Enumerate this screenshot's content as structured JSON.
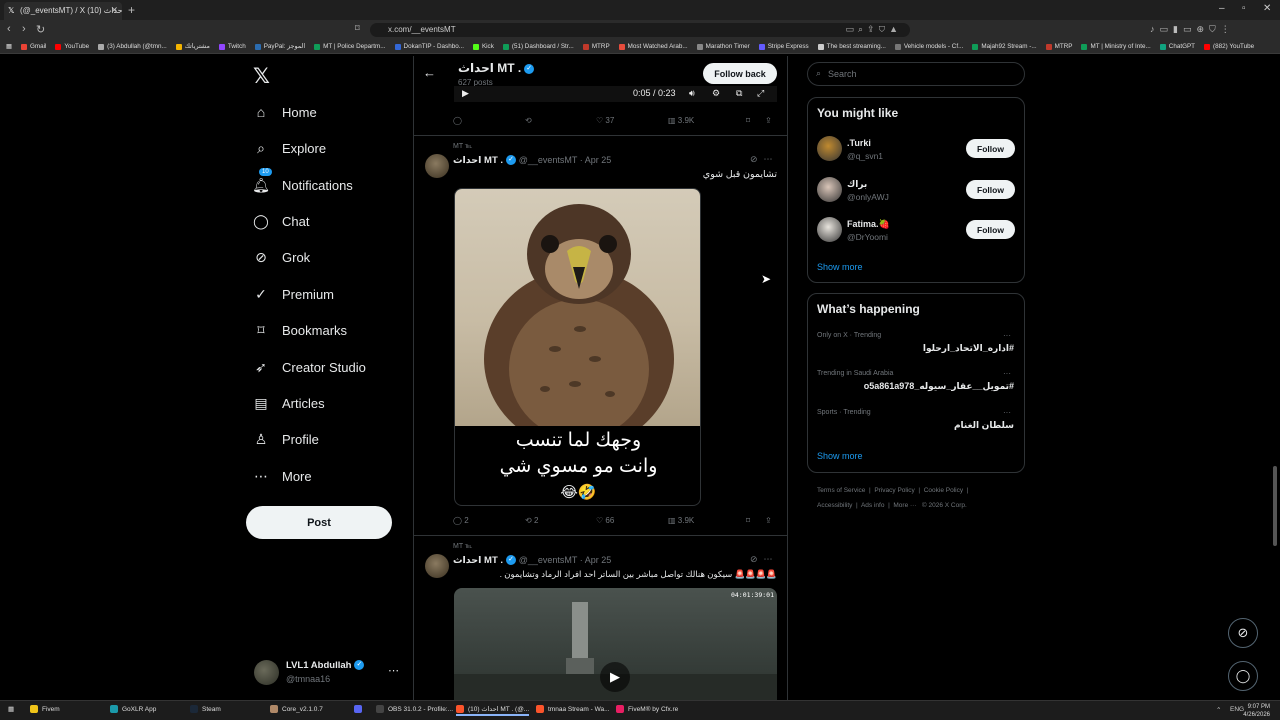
{
  "browser": {
    "tab_title": "(@_eventsMT) / X احداث (10)",
    "url": "x.com/__eventsMT",
    "bookmarks": [
      "Gmail",
      "YouTube",
      "(3) Abdullah (@tmn...",
      "مشترياتك",
      "Twitch",
      "PayPal: الموجز",
      "MT | Police Departm...",
      "DokanTIP - Dashbo...",
      "Kick",
      "(51) Dashboard / Str...",
      "MTRP",
      "Most Watched Arab...",
      "Marathon Timer",
      "Stripe Express",
      "The best streaming...",
      "Vehicle models - Cf...",
      "Majah92 Stream -...",
      "MTRP",
      "MT | Ministry of Inte...",
      "ChatGPT",
      "(882) YouTube"
    ],
    "bookmark_colors": [
      "#ea4335",
      "#ff0000",
      "#aaaaaa",
      "#f4b400",
      "#9146ff",
      "#2b6cb0",
      "#0f9d58",
      "#3367d6",
      "#53fc18",
      "#0f9d58",
      "#c0392b",
      "#e74c3c",
      "#888888",
      "#635bff",
      "#cccccc",
      "#777777",
      "#0f9d58",
      "#c0392b",
      "#0f9d58",
      "#10a37f",
      "#ff0000"
    ]
  },
  "sidebar": {
    "logo": "𝕏",
    "items": [
      {
        "label": "Home",
        "icon": "⌂",
        "name": "home"
      },
      {
        "label": "Explore",
        "icon": "⌕",
        "name": "explore"
      },
      {
        "label": "Notifications",
        "icon": "🔔︎",
        "name": "notifications"
      },
      {
        "label": "Chat",
        "icon": "◯",
        "name": "chat"
      },
      {
        "label": "Grok",
        "icon": "⊘",
        "name": "grok"
      },
      {
        "label": "Premium",
        "icon": "✓",
        "name": "premium"
      },
      {
        "label": "Bookmarks",
        "icon": "⌑",
        "name": "bookmarks"
      },
      {
        "label": "Creator Studio",
        "icon": "➶",
        "name": "creator-studio"
      },
      {
        "label": "Articles",
        "icon": "▤",
        "name": "articles"
      },
      {
        "label": "Profile",
        "icon": "♙",
        "name": "profile"
      },
      {
        "label": "More",
        "icon": "⋯",
        "name": "more"
      }
    ],
    "notif_count": "10",
    "post_label": "Post",
    "account": {
      "name": "LVL1 Abdullah",
      "handle": "@tmnaa16",
      "more": "⋯"
    }
  },
  "profile_header": {
    "back": "←",
    "title": "احداث MT .",
    "posts_count": "627 posts",
    "follow_back_label": "Follow back"
  },
  "video_top": {
    "time": "0:05 / 0:23",
    "play": "▶",
    "volume": "🔊︎",
    "settings": "⚙",
    "pip": "⧉",
    "fullscreen": "⤢"
  },
  "posts": [
    {
      "actions": {
        "reply": "",
        "repost": "",
        "like": "37",
        "views": "3.9K"
      }
    },
    {
      "pin": "MT ℡",
      "name": "احداث MT .",
      "handle": "@__eventsMT",
      "date": "Apr 25",
      "text": "تشايمون قبل شوي",
      "media_caption_line1": "وجهك لما تنسب",
      "media_caption_line2": "وانت مو مسوي شي",
      "media_emoji": "😂🤣",
      "actions": {
        "reply": "2",
        "repost": "2",
        "like": "66",
        "views": "3.9K"
      }
    },
    {
      "pin": "MT ℡",
      "name": "احداث MT .",
      "handle": "@__eventsMT",
      "date": "Apr 25",
      "text": "🚨🚨🚨🚨 سيكون هنالك تواصل مباشر بين الساتر احد افراد الرماد وتشايمون .",
      "video_timestamp": "04:01:39:01"
    }
  ],
  "right": {
    "search_placeholder": "Search",
    "suggest_title": "You might like",
    "suggestions": [
      {
        "name": ".Turki",
        "handle": "@q_svn1",
        "follow": "Follow",
        "color": "#c08a30"
      },
      {
        "name": "براك",
        "handle": "@onlyAWJ",
        "follow": "Follow",
        "color": "#d9c5b8"
      },
      {
        "name": "Fatima.🍓",
        "handle": "@DrYoomi",
        "follow": "Follow",
        "color": "#e8e4dd"
      }
    ],
    "show_more": "Show more",
    "happening_title": "What’s happening",
    "trends": [
      {
        "context": "Only on X · Trending",
        "tag": "#اداره_الاتحاد_ارحلوا"
      },
      {
        "context": "Trending in Saudi Arabia",
        "tag": "#تمويل__عقار_سيوله_o5a861a978"
      },
      {
        "context": "Sports · Trending",
        "tag": "سلطان الغنام"
      }
    ],
    "footer_line1": [
      "Terms of Service",
      "Privacy Policy",
      "Cookie Policy"
    ],
    "footer_line2": [
      "Accessibility",
      "Ads info",
      "More ···",
      "© 2026 X Corp."
    ]
  },
  "taskbar": {
    "apps": [
      "Fivem",
      "GoXLR App",
      "Steam",
      "Core_v2.1.0.7",
      "",
      "OBS 31.0.2 - Profile:...",
      "(10) احداث MT . (@...",
      "tmnaa Stream - Wa...",
      "FiveM® by Cfx.re"
    ],
    "lang": "ENG",
    "time": "9:07 PM",
    "date": "4/26/2026"
  }
}
